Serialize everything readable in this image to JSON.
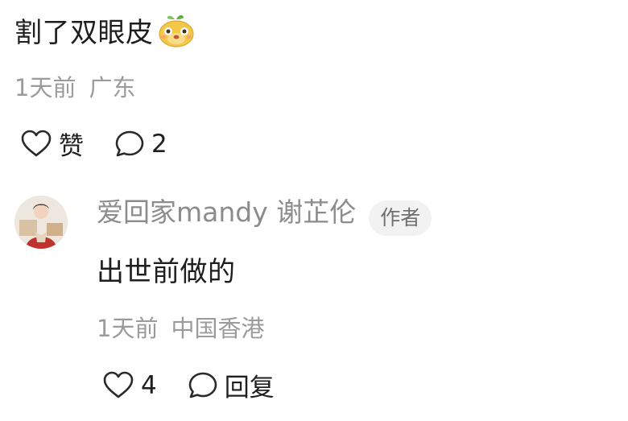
{
  "comment1": {
    "text": "割了双眼皮",
    "emoji_icon": "cute-mango-face-emoji",
    "time": "1天前",
    "location": "广东",
    "like_label": "赞",
    "reply_count": "2"
  },
  "reply1": {
    "username": "爱回家mandy 谢芷伦",
    "badge": "作者",
    "text": "出世前做的",
    "time": "1天前",
    "location": "中国香港",
    "like_count": "4",
    "reply_label": "回复"
  },
  "icons": {
    "heart": "heart-outline-icon",
    "bubble": "speech-bubble-icon"
  },
  "colors": {
    "meta_text": "#9b9b9b",
    "badge_bg": "#f2f2f2",
    "emoji_yellow": "#f3c747"
  }
}
